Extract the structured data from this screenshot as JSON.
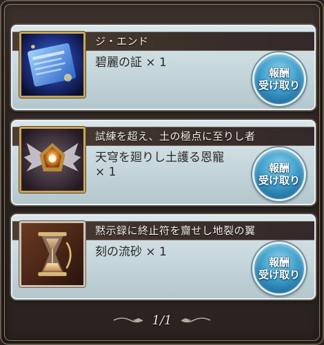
{
  "rewards": [
    {
      "title": "ジ・エンド",
      "item_name": "碧麗の証",
      "quantity": "× 1",
      "icon": "blue-scroll-icon",
      "claim_line1": "報酬",
      "claim_line2": "受け取り"
    },
    {
      "title": "試練を超え、土の極点に至りし者",
      "item_name": "天穹を廻りし土護る恩寵",
      "quantity": "× 1",
      "icon": "winged-gem-icon",
      "claim_line1": "報酬",
      "claim_line2": "受け取り"
    },
    {
      "title": "黙示録に終止符を齎せし地裂の翼",
      "item_name": "刻の流砂",
      "quantity": "× 1",
      "icon": "hourglass-icon",
      "claim_line1": "報酬",
      "claim_line2": "受け取り"
    }
  ],
  "pagination": {
    "label": "1/1"
  },
  "colors": {
    "claim_button": "#3f9fcc",
    "card_background": "#c6d7dc",
    "title_bar": "#3a2f29",
    "frame_gold": "#c9a55a"
  }
}
